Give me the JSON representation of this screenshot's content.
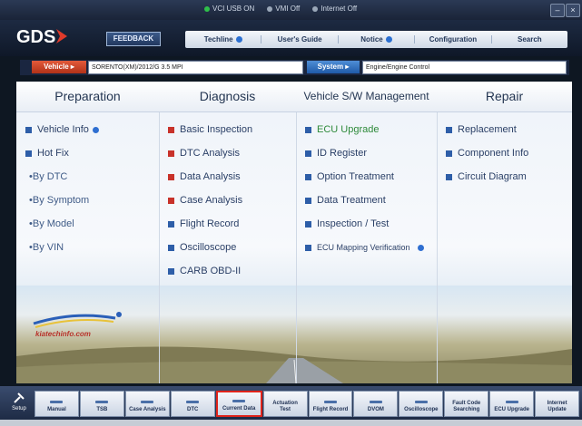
{
  "status": {
    "items": [
      "VCI",
      "USB ON",
      "VMI",
      "Off",
      "Internet",
      "Off"
    ],
    "min_btn": "–",
    "close_btn": "×"
  },
  "header": {
    "logo": "GDS",
    "feedback": "FEEDBACK",
    "nav": [
      {
        "label": "Techline",
        "info": true
      },
      {
        "label": "User's Guide",
        "info": false
      },
      {
        "label": "Notice",
        "info": true
      },
      {
        "label": "Configuration",
        "info": false
      },
      {
        "label": "Search",
        "info": false
      }
    ]
  },
  "vehicle_bar": {
    "vehicle_label": "Vehicle",
    "vehicle_value": "SORENTO(XM)/2012/G 3.5 MPI",
    "system_label": "System",
    "system_value": "Engine/Engine Control"
  },
  "columns": {
    "preparation": {
      "title": "Preparation",
      "items": [
        "Vehicle Info",
        "Hot Fix",
        "By DTC",
        "By Symptom",
        "By Model",
        "By VIN"
      ]
    },
    "diagnosis": {
      "title": "Diagnosis",
      "items": [
        "Basic Inspection",
        "DTC Analysis",
        "Data Analysis",
        "Case Analysis",
        "Flight Record",
        "Oscilloscope",
        "CARB OBD-II"
      ]
    },
    "sw": {
      "title": "Vehicle S/W Management",
      "items": [
        "ECU Upgrade",
        "ID Register",
        "Option Treatment",
        "Data Treatment",
        "Inspection / Test",
        "ECU Mapping Verification"
      ]
    },
    "repair": {
      "title": "Repair",
      "items": [
        "Replacement",
        "Component Info",
        "Circuit Diagram"
      ]
    }
  },
  "kia_logo_text": "kiatechinfo.com",
  "toolbar": {
    "setup": "Setup",
    "buttons": [
      "Manual",
      "TSB",
      "Case Analysis",
      "DTC",
      "Current Data",
      "Actuation Test",
      "Flight Record",
      "DVOM",
      "Oscilloscope",
      "Fault Code Searching",
      "ECU Upgrade",
      "Internet Update"
    ],
    "active": "Current Data"
  },
  "colors": {
    "accent_red": "#e0241b",
    "brand_blue": "#24385a",
    "vehicle_red": "#c8322a"
  }
}
